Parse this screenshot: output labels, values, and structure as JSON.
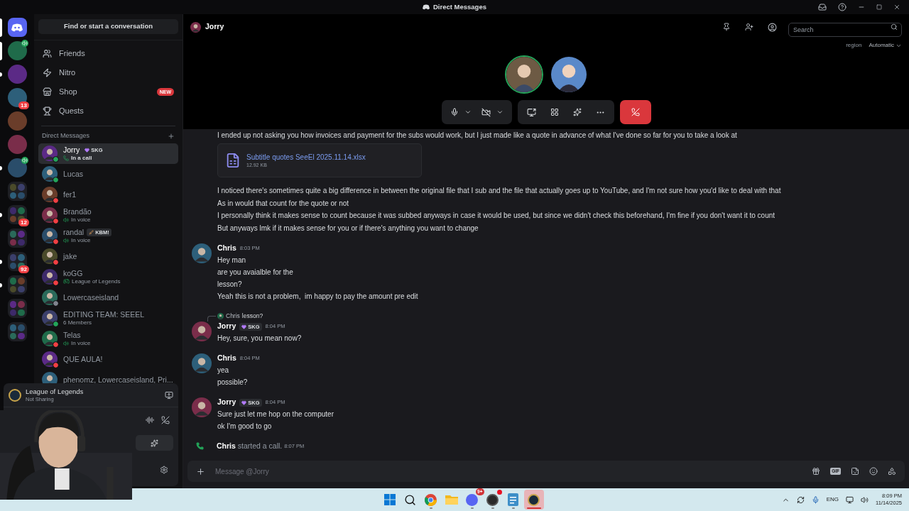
{
  "title_bar": {
    "title": "Direct Messages"
  },
  "server_rail": [
    {
      "kind": "home",
      "selected": true,
      "unread": false,
      "voice": false
    },
    {
      "kind": "server",
      "selected": true,
      "unread": false,
      "voice": true
    },
    {
      "kind": "server",
      "selected": false,
      "unread": true,
      "voice": false
    },
    {
      "kind": "server",
      "selected": false,
      "unread": false,
      "voice": false,
      "badge": "13"
    },
    {
      "kind": "server",
      "selected": false,
      "unread": false,
      "voice": false
    },
    {
      "kind": "server",
      "selected": false,
      "unread": false,
      "voice": false
    },
    {
      "kind": "server",
      "selected": false,
      "unread": true,
      "voice": true
    },
    {
      "kind": "folder",
      "selected": false,
      "unread": false,
      "voice": false
    },
    {
      "kind": "folder",
      "selected": false,
      "unread": true,
      "voice": false,
      "badge": "12"
    },
    {
      "kind": "folder",
      "selected": false,
      "unread": false,
      "voice": false
    },
    {
      "kind": "folder",
      "selected": false,
      "unread": true,
      "voice": false,
      "badge": "92"
    },
    {
      "kind": "folder",
      "selected": false,
      "unread": true,
      "voice": false
    },
    {
      "kind": "folder",
      "selected": false,
      "unread": false,
      "voice": false
    },
    {
      "kind": "folder",
      "selected": false,
      "unread": false,
      "voice": false
    }
  ],
  "sidebar": {
    "search": "Find or start a conversation",
    "nav": [
      {
        "kind": "friends",
        "label": "Friends"
      },
      {
        "kind": "nitro",
        "label": "Nitro"
      },
      {
        "kind": "shop",
        "label": "Shop",
        "badge": "NEW"
      },
      {
        "kind": "quests",
        "label": "Quests"
      }
    ],
    "dm_header": "Direct Messages",
    "dms": [
      {
        "name": "Jorry",
        "tag": {
          "kind": "heart",
          "text": "SKG"
        },
        "color": "#23a55a",
        "activity": {
          "kind": "call",
          "text": "In a call"
        },
        "selected": true
      },
      {
        "name": "Lucas",
        "color": "#23a55a",
        "selected": false
      },
      {
        "name": "fer1",
        "color": "#f23f43",
        "selected": false
      },
      {
        "name": "Brandão",
        "color": "#f23f43",
        "activity": {
          "kind": "voice",
          "text": "In voice"
        },
        "selected": false
      },
      {
        "name": "randal",
        "tag": {
          "kind": "sword",
          "text": "KBM!"
        },
        "color": "#f23f43",
        "activity": {
          "kind": "voice",
          "text": "In voice"
        },
        "selected": false
      },
      {
        "name": "jake",
        "color": "#f23f43",
        "selected": false
      },
      {
        "name": "koGG",
        "color": "#f23f43",
        "activity": {
          "kind": "game",
          "text": "League of Legends"
        },
        "selected": false
      },
      {
        "name": "Lowercaseisland",
        "color": "#80848e",
        "selected": false
      },
      {
        "name": "EDITING TEAM: SEEEL",
        "color": "#23a55a",
        "activity": {
          "kind": "text",
          "text": "6 Members"
        },
        "selected": false
      },
      {
        "name": "Telas",
        "color": "#f23f43",
        "activity": {
          "kind": "voice",
          "text": "In voice"
        },
        "selected": false
      },
      {
        "name": "QUE AULA!",
        "color": "#f23f43",
        "selected": false
      },
      {
        "name": "phenomz, Lowercaseisland, Pri...",
        "selected": false
      }
    ],
    "panel": {
      "game": "League of Legends",
      "sharing": "Not Sharing"
    }
  },
  "header": {
    "name": "Jorry",
    "search_placeholder": "Search",
    "region_label": "region",
    "region_value": "Automatic"
  },
  "call": {
    "participants": [
      {
        "speaking": true
      },
      {
        "speaking": false
      }
    ]
  },
  "messages": [
    {
      "kind": "continuation",
      "lines_before": [
        "I ended up not asking you how invoices and payment for the subs would work, but I just made like a quote in advance of what I've done so far for you to take a look at"
      ],
      "attachment": {
        "name": "Subtitle quotes SeeEl 2025.11.14.xlsx",
        "size": "12.92 KB"
      },
      "lines_after": [
        "I noticed there's sometimes quite a big difference in between the original file that I sub and the file that actually goes up to YouTube, and I'm not sure how you'd like to deal with that",
        "As in would that count for the quote or not",
        "I personally think it makes sense to count because it was subbed anyways in case it would be used, but since we didn't check this beforehand, I'm fine if you don't want it to count",
        "But anyways lmk if it makes sense for you or if there's anything you want to change"
      ]
    },
    {
      "kind": "message",
      "author": "Chris",
      "time": "8:03 PM",
      "lines": [
        "Hey man",
        "are you avaialble for the",
        "lesson?",
        "Yeah this is not a problem,  im happy to pay the amount pre edit"
      ]
    },
    {
      "kind": "message",
      "author": "Jorry",
      "tag": "SKG",
      "time": "8:04 PM",
      "reply": {
        "author": "Chris",
        "text": "lesson?"
      },
      "lines": [
        "Hey, sure, you mean now?"
      ]
    },
    {
      "kind": "message",
      "author": "Chris",
      "time": "8:04 PM",
      "lines": [
        "yea",
        "possible?"
      ]
    },
    {
      "kind": "message",
      "author": "Jorry",
      "tag": "SKG",
      "time": "8:04 PM",
      "lines": [
        "Sure just let me hop on the computer",
        "ok I'm good to go"
      ]
    },
    {
      "kind": "system",
      "author": "Chris",
      "text": "started a call.",
      "time": "8:07 PM"
    }
  ],
  "composer": {
    "placeholder": "Message @Jorry",
    "gif_label": "GIF"
  },
  "taskbar": {
    "apps": [
      {
        "kind": "start",
        "running": false,
        "selected": false
      },
      {
        "kind": "search",
        "running": false,
        "selected": false
      },
      {
        "kind": "browser",
        "running": true,
        "selected": false
      },
      {
        "kind": "files",
        "running": false,
        "selected": false
      },
      {
        "kind": "chat",
        "running": true,
        "selected": false,
        "badge": "9+"
      },
      {
        "kind": "recorder",
        "running": true,
        "selected": false
      },
      {
        "kind": "notes",
        "running": true,
        "selected": false
      },
      {
        "kind": "game",
        "running": true,
        "selected": true
      }
    ],
    "language": "ENG",
    "time": "8:09 PM",
    "date": "11/14/2025"
  }
}
